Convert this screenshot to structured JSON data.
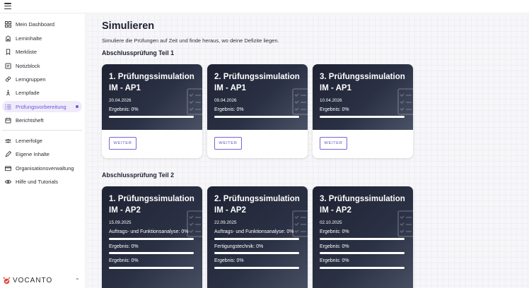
{
  "sidebar": {
    "items": [
      {
        "label": "Mein Dashboard",
        "icon": "dashboard-icon"
      },
      {
        "label": "Lerninhalte",
        "icon": "books-icon"
      },
      {
        "label": "Merkliste",
        "icon": "bookmark-icon"
      },
      {
        "label": "Notizblock",
        "icon": "notepad-icon"
      },
      {
        "label": "Lerngruppen",
        "icon": "group-icon"
      },
      {
        "label": "Lernpfade",
        "icon": "path-icon"
      },
      {
        "label": "Prüfungsvorbereitung",
        "icon": "list-icon"
      },
      {
        "label": "Berichtsheft",
        "icon": "calendar-icon"
      }
    ],
    "items2": [
      {
        "label": "Lernerfolge",
        "icon": "people-icon"
      },
      {
        "label": "Eigene Inhalte",
        "icon": "pencil-icon"
      },
      {
        "label": "Organisationsverwaltung",
        "icon": "card-icon"
      },
      {
        "label": "Hilfe und Tutorials",
        "icon": "eye-icon"
      }
    ],
    "brand": "VOCANTO",
    "collapse_icon": "chevron-up-icon"
  },
  "main": {
    "title": "Simulieren",
    "subtitle": "Simuliere die Prüfungen auf Zeit und finde heraus, wo deine Defizite liegen.",
    "sections": [
      {
        "title": "Abschlussprüfung Teil 1",
        "cards": [
          {
            "title": "1. Prüfungssimulation IM - AP1",
            "date": "20.04.2026",
            "results": [
              {
                "label": "Ergebnis: 0%",
                "progress": 0
              }
            ],
            "button": "WEITER"
          },
          {
            "title": "2. Prüfungssimulation IM - AP1",
            "date": "09.04.2026",
            "results": [
              {
                "label": "Ergebnis: 0%",
                "progress": 0
              }
            ],
            "button": "WEITER"
          },
          {
            "title": "3. Prüfungssimulation IM - AP1",
            "date": "10.04.2026",
            "results": [
              {
                "label": "Ergebnis: 0%",
                "progress": 0
              }
            ],
            "button": "WEITER"
          }
        ]
      },
      {
        "title": "Abschlussprüfung Teil 2",
        "cards": [
          {
            "title": "1. Prüfungssimulation IM - AP2",
            "date": "15.09.2025",
            "results": [
              {
                "label": "Auftrags- und Funktionsanalyse: 0%",
                "progress": 0
              },
              {
                "label": "Ergebnis: 0%",
                "progress": 0
              },
              {
                "label": "Ergebnis: 0%",
                "progress": 0
              }
            ]
          },
          {
            "title": "2. Prüfungssimulation IM - AP2",
            "date": "22.09.2025",
            "results": [
              {
                "label": "Auftrags- und Funktionsanalyse: 0%",
                "progress": 0
              },
              {
                "label": "Fertigungstechnik: 0%",
                "progress": 0
              },
              {
                "label": "Ergebnis: 0%",
                "progress": 0
              }
            ]
          },
          {
            "title": "3. Prüfungssimulation IM - AP2",
            "date": "02.10.2025",
            "results": [
              {
                "label": "Ergebnis: 0%",
                "progress": 0
              },
              {
                "label": "Ergebnis: 0%",
                "progress": 0
              },
              {
                "label": "Ergebnis: 0%",
                "progress": 0
              }
            ]
          }
        ]
      }
    ]
  },
  "colors": {
    "accent": "#6f57d6",
    "card_dark": "#1e2233",
    "active_bg": "#efebfb"
  }
}
